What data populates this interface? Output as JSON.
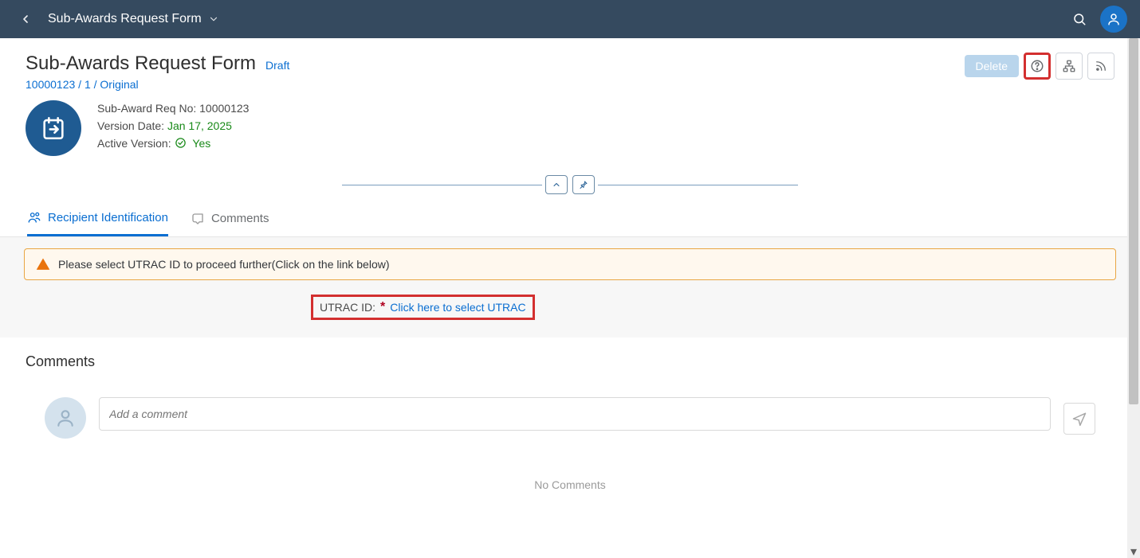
{
  "header": {
    "title": "Sub-Awards Request Form"
  },
  "page": {
    "title": "Sub-Awards Request Form",
    "status": "Draft",
    "sub_id": "10000123 / 1 / Original",
    "delete_label": "Delete"
  },
  "info": {
    "req_no_label": "Sub-Award Req No:",
    "req_no_value": "10000123",
    "version_date_label": "Version Date:",
    "version_date_value": "Jan 17, 2025",
    "active_version_label": "Active Version:",
    "active_version_value": "Yes"
  },
  "tabs": {
    "recipient": "Recipient Identification",
    "comments": "Comments"
  },
  "warning": {
    "text": "Please select UTRAC ID to proceed further(Click on the link below)"
  },
  "utrac": {
    "label": "UTRAC ID:",
    "link": "Click here to select UTRAC"
  },
  "comments_section": {
    "title": "Comments",
    "placeholder": "Add a comment",
    "no_comments": "No Comments"
  }
}
